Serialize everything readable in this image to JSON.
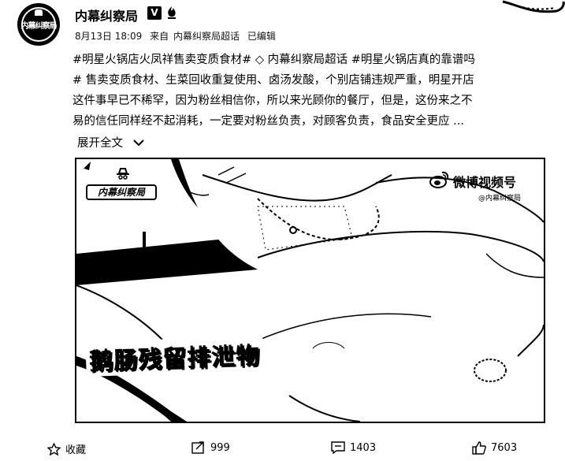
{
  "post": {
    "author": "内幕纠察局",
    "verified_badge": "V",
    "timestamp": "8月13日 18:09",
    "source_prefix": "来自",
    "source": "内幕纠察局超话",
    "edited": "已编辑",
    "text_lines": [
      "#明星火锅店火凤祥售卖变质食材#  ◇ 内幕纠察局超话  #明星火锅店真的靠谱吗",
      "#  售卖变质食材、生菜回收重复使用、卤汤发酸，个别店铺违规严重，明星开店",
      "这件事早已不稀罕，因为粉丝相信你，所以来光顾你的餐厅，但是，这份来之不",
      "易的信任同样经不起消耗，一定要对粉丝负责，对顾客负责，食品安全更应 ..."
    ],
    "expand_label": "展开全文",
    "expand_icon": "chevron-down-icon"
  },
  "video": {
    "channel_logo_text": "内幕纠察局",
    "platform_name": "微博视频号",
    "platform_handle": "@内幕纠察局",
    "subtitle": "鹅肠残留排泄物"
  },
  "actions": {
    "favorite_label": "收藏",
    "repost_count": "999",
    "comment_count": "1403",
    "like_count": "7603"
  }
}
